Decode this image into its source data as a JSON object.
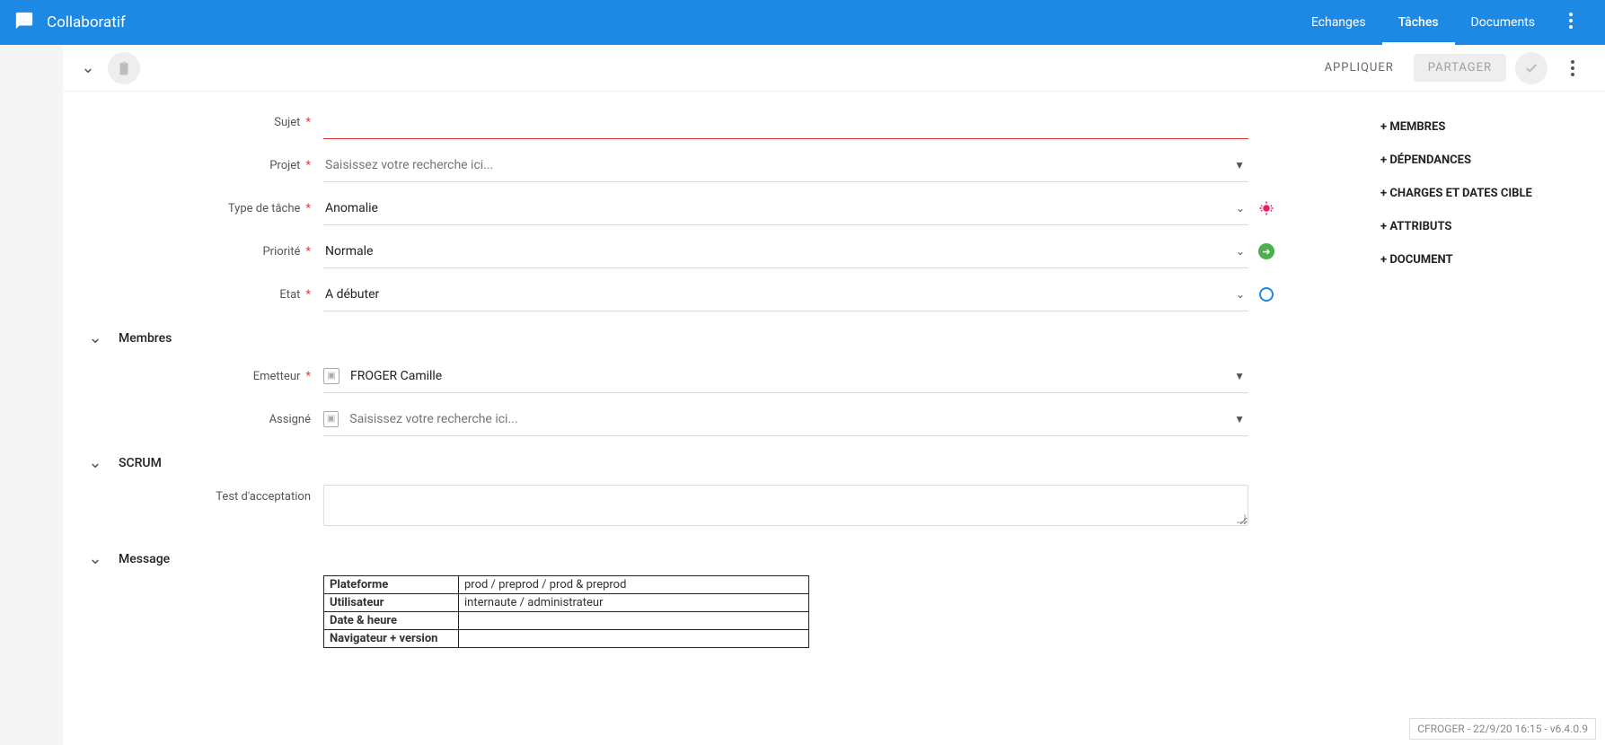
{
  "header": {
    "title": "Collaboratif",
    "tabs": [
      "Echanges",
      "Tâches",
      "Documents"
    ],
    "active_tab": 1
  },
  "toolbar": {
    "apply": "APPLIQUER",
    "share": "PARTAGER"
  },
  "form": {
    "subject": {
      "label": "Sujet",
      "value": ""
    },
    "project": {
      "label": "Projet",
      "placeholder": "Saisissez votre recherche ici..."
    },
    "task_type": {
      "label": "Type de tâche",
      "value": "Anomalie"
    },
    "priority": {
      "label": "Priorité",
      "value": "Normale"
    },
    "state": {
      "label": "Etat",
      "value": "A débuter"
    }
  },
  "sections": {
    "members": {
      "title": "Membres",
      "emitter": {
        "label": "Emetteur",
        "value": "FROGER Camille"
      },
      "assignee": {
        "label": "Assigné",
        "placeholder": "Saisissez votre recherche ici..."
      }
    },
    "scrum": {
      "title": "SCRUM",
      "test_accept": {
        "label": "Test d'acceptation"
      }
    },
    "message": {
      "title": "Message"
    }
  },
  "side_links": [
    "+ MEMBRES",
    "+ DÉPENDANCES",
    "+ CHARGES ET DATES CIBLE",
    "+ ATTRIBUTS",
    "+ DOCUMENT"
  ],
  "msg_table": [
    [
      "Plateforme",
      "prod / preprod / prod & preprod"
    ],
    [
      "Utilisateur",
      "internaute / administrateur"
    ],
    [
      "Date & heure",
      ""
    ],
    [
      "Navigateur + version",
      ""
    ]
  ],
  "footer": "CFROGER - 22/9/20 16:15 - v6.4.0.9"
}
